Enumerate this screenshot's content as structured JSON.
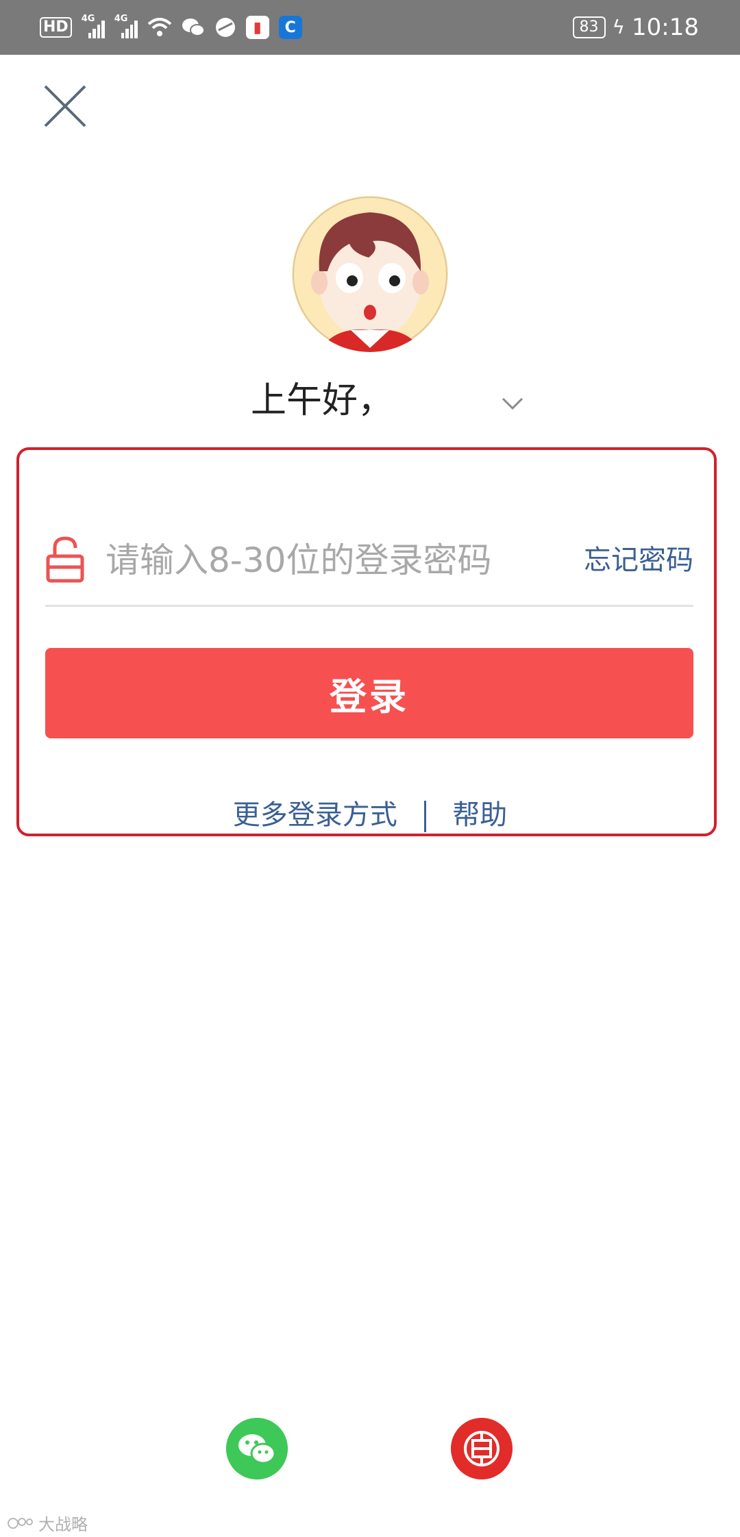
{
  "status_bar": {
    "hd_label": "HD",
    "sim1_network": "4G",
    "sim2_network": "4G",
    "battery": "83",
    "time": "10:18",
    "icons": [
      "hd-icon",
      "signal-icon",
      "signal-icon",
      "wifi-icon",
      "wechat-icon",
      "browser-icon",
      "book-icon",
      "bank-app-icon",
      "charging-icon"
    ]
  },
  "header": {
    "close_icon": "close-icon"
  },
  "profile": {
    "greeting": "上午好，",
    "dropdown_icon": "chevron-down-icon"
  },
  "login_form": {
    "password_placeholder": "请输入8-30位的登录密码",
    "password_value": "",
    "forgot_password": "忘记密码",
    "login_button": "登录",
    "more_login_methods": "更多登录方式",
    "help": "帮助"
  },
  "third_party_login": [
    {
      "icon": "wechat-icon",
      "color": "#3ec857"
    },
    {
      "icon": "icbc-icon",
      "color": "#e22c29"
    }
  ],
  "watermark": {
    "text": "大战略"
  },
  "colors": {
    "accent_red": "#f75050",
    "highlight_border": "#d1202c",
    "link_blue": "#3a5f95"
  }
}
